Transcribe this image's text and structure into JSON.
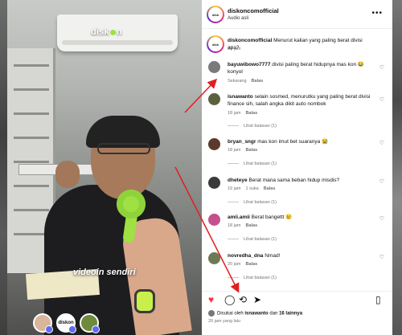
{
  "video": {
    "brand": "diskon",
    "caption": "videoin sendiri",
    "avatars": [
      "",
      "diskon",
      ""
    ]
  },
  "post": {
    "username": "diskoncomofficial",
    "audio": "Audio asli",
    "more_icon": "more-horizontal-icon"
  },
  "caption": {
    "username": "diskoncomofficial",
    "text": "Menurut kalian yang paling berat divisi apa?",
    "time": "20 jam"
  },
  "comments": [
    {
      "user": "bayuwibowo7777",
      "text": "divisi paling berat hidupnya mas kon 😂 konyol",
      "time": "Sekarang",
      "likes": "",
      "reply": "Balas",
      "replies": ""
    },
    {
      "user": "isnawanto",
      "text": "selain sosmed, menurutku yang paling berat divisi finance sih, salah angka dikit auto nombok",
      "time": "18 jam",
      "likes": "",
      "reply": "Balas",
      "replies": "Lihat balasan (1)"
    },
    {
      "user": "bryan_sngr",
      "text": "mas kon imut bet suaranya 😭",
      "time": "18 jam",
      "likes": "",
      "reply": "Balas",
      "replies": "Lihat balasan (1)"
    },
    {
      "user": "dheteye",
      "text": "Berat mana sama beban hidup misdis?",
      "time": "19 jam",
      "likes": "1 suka",
      "reply": "Balas",
      "replies": "Lihat balasan (1)"
    },
    {
      "user": "amii.amii",
      "text": "Berat bangettt 😢",
      "time": "18 jam",
      "likes": "",
      "reply": "Balas",
      "replies": "Lihat balasan (1)"
    },
    {
      "user": "novredha_dna",
      "text": "Nmad!",
      "time": "20 jam",
      "likes": "",
      "reply": "Balas",
      "replies": "Lihat balasan (1)"
    }
  ],
  "actions": {
    "like": "♥",
    "comment": "◯",
    "repost": "⟲",
    "share": "➤",
    "save": "▯"
  },
  "likes": {
    "prefix": "Disukai oleh",
    "user": "isnawanto",
    "mid": "dan",
    "count": "16 lainnya"
  },
  "posted": "20 jam yang lalu",
  "colors": {
    "like_red": "#ff3040",
    "arrow_red": "#e02020",
    "mic_green": "#9fe142"
  }
}
